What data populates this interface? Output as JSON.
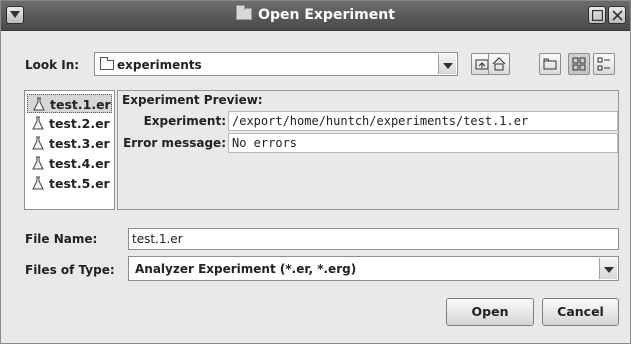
{
  "window": {
    "title": "Open Experiment"
  },
  "look_in": {
    "label": "Look In:",
    "value": "experiments"
  },
  "toolbar": {
    "icons": [
      "up-folder-icon",
      "home-icon",
      "new-folder-icon",
      "list-view-icon",
      "details-view-icon"
    ]
  },
  "files": {
    "items": [
      {
        "name": "test.1.er",
        "selected": true
      },
      {
        "name": "test.2.er",
        "selected": false
      },
      {
        "name": "test.3.er",
        "selected": false
      },
      {
        "name": "test.4.er",
        "selected": false
      },
      {
        "name": "test.5.er",
        "selected": false
      }
    ]
  },
  "preview": {
    "title": "Experiment Preview:",
    "experiment_label": "Experiment:",
    "experiment_value": "/export/home/huntch/experiments/test.1.er",
    "error_label": "Error message:",
    "error_value": "No errors"
  },
  "file_name": {
    "label": "File Name:",
    "value": "test.1.er"
  },
  "file_type": {
    "label": "Files of Type:",
    "value": "Analyzer Experiment (*.er, *.erg)"
  },
  "buttons": {
    "open": "Open",
    "cancel": "Cancel"
  },
  "colors": {
    "titlebar": "#5a5a5a",
    "window_bg": "#e9e9e9"
  }
}
